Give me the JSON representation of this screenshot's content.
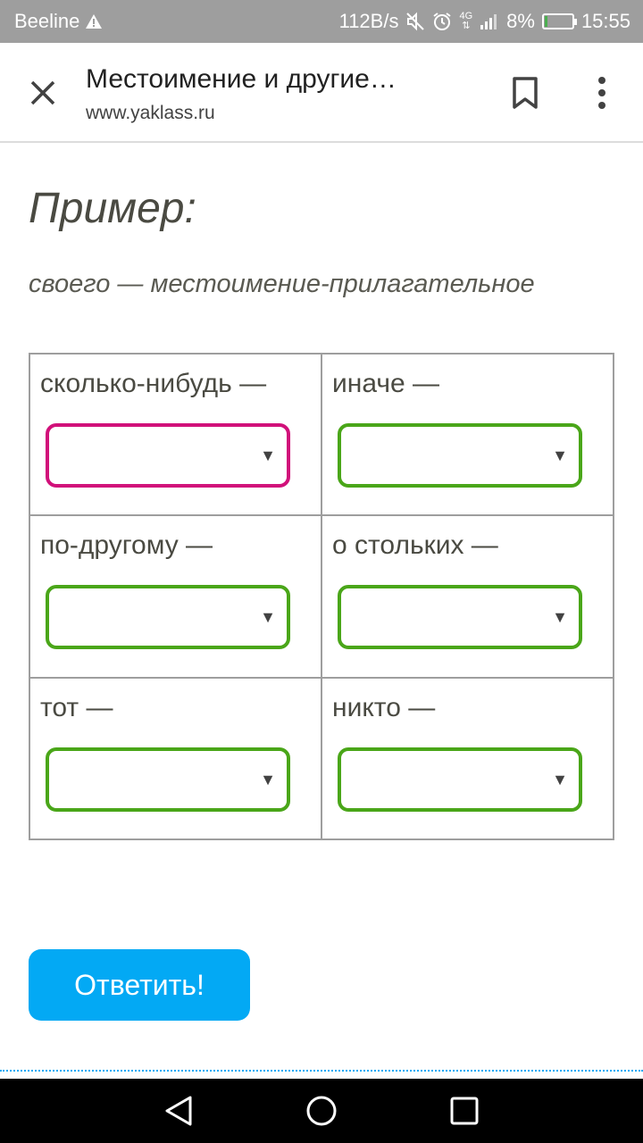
{
  "status_bar": {
    "carrier": "Beeline",
    "speed": "112B/s",
    "network": "4G",
    "battery": "8%",
    "time": "15:55"
  },
  "toolbar": {
    "title": "Местоимение и другие…",
    "url": "www.yaklass.ru"
  },
  "content": {
    "heading": "Пример:",
    "example": "своего — местоимение-прилагательное",
    "cells": [
      {
        "word": "сколько-нибудь —",
        "value": "",
        "state": "active"
      },
      {
        "word": "иначе —",
        "value": "",
        "state": "normal"
      },
      {
        "word": "по-другому —",
        "value": "",
        "state": "normal"
      },
      {
        "word": "о стольких —",
        "value": "",
        "state": "normal"
      },
      {
        "word": "тот —",
        "value": "",
        "state": "normal"
      },
      {
        "word": "никто —",
        "value": "",
        "state": "normal"
      }
    ],
    "select_arrow": "▼",
    "submit_label": "Ответить!"
  },
  "colors": {
    "accent": "#03a9f4",
    "select_border": "#4aa619",
    "select_active_border": "#d1117a",
    "status_bar": "#9e9e9e"
  },
  "icons": {
    "close": "close-icon",
    "bookmark": "bookmark-icon",
    "menu": "more-vert-icon",
    "back": "nav-back-icon",
    "home": "nav-home-icon",
    "recents": "nav-recents-icon"
  }
}
